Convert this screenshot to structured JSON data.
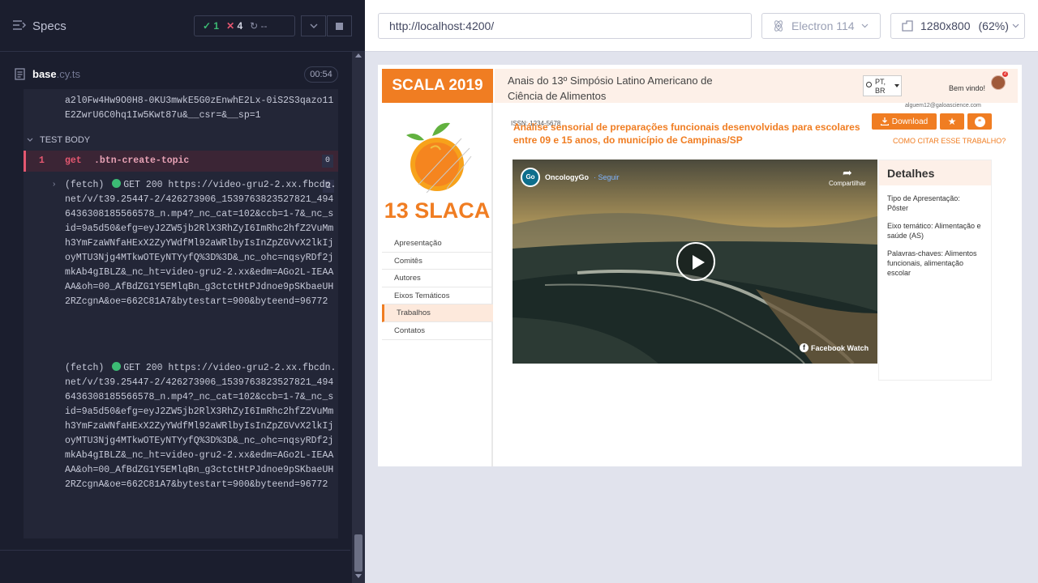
{
  "runner": {
    "specs_label": "Specs",
    "passed": "1",
    "failed": "4",
    "pending": "--",
    "file_name": "base",
    "file_ext": ".cy.ts",
    "duration": "00:54",
    "prev_log": "a2l0Fw4Hw9O0H8-0KU3mwkE5G0zEnwhE2Lx-0iS2S3qazo11E2ZwrU6C0hq1Iw5Kwt87u&__csr=&__sp=1",
    "test_body_label": "TEST BODY",
    "command": {
      "number": "1",
      "name": "get",
      "selector": ".btn-create-topic",
      "count": "0"
    },
    "fetch_count": "2",
    "fetch_logs": [
      {
        "prefix": "(fetch)",
        "text": "GET 200 https://video-gru2-2.xx.fbcdn.net/v/t39.25447-2/426273906_1539763823527821_4946436308185566578_n.mp4?_nc_cat=102&ccb=1-7&_nc_sid=9a5d50&efg=eyJ2ZW5jb2RlX3RhZyI6ImRhc2hfZ2VuMmh3YmFzaWNfaHExX2ZyYWdfMl92aWRlbyIsInZpZGVvX2lkIjoyMTU3Njg4MTkwOTEyNTYyfQ%3D%3D&_nc_ohc=nqsyRDf2jmkAb4gIBLZ&_nc_ht=video-gru2-2.xx&edm=AGo2L-IEAAAA&oh=00_AfBdZG1Y5EMlqBn_g3ctctHtPJdnoe9pSKbaeUH2RZcgnA&oe=662C81A7&bytestart=900&byteend=96772"
      },
      {
        "prefix": "(fetch)",
        "text": "GET 200 https://video-gru2-2.xx.fbcdn.net/v/t39.25447-2/426273906_1539763823527821_4946436308185566578_n.mp4?_nc_cat=102&ccb=1-7&_nc_sid=9a5d50&efg=eyJ2ZW5jb2RlX3RhZyI6ImRhc2hfZ2VuMmh3YmFzaWNfaHExX2ZyYWdfMl92aWRlbyIsInZpZGVvX2lkIjoyMTU3Njg4MTkwOTEyNTYyfQ%3D%3D&_nc_ohc=nqsyRDf2jmkAb4gIBLZ&_nc_ht=video-gru2-2.xx&edm=AGo2L-IEAAAA&oh=00_AfBdZG1Y5EMlqBn_g3ctctHtPJdnoe9pSKbaeUH2RZcgnA&oe=662C81A7&bytestart=900&byteend=96772"
      }
    ]
  },
  "preview": {
    "url": "http://localhost:4200/",
    "browser": "Electron 114",
    "viewport": "1280x800",
    "scale": "(62%)"
  },
  "site": {
    "logo_text": "SCALA 2019",
    "emblem_text": "13 SLACA",
    "header_title": "Anais do 13º Simpósio Latino Americano de Ciência de Alimentos",
    "lang": "PT, BR",
    "welcome": "Bem vindo!",
    "notif_count": "2",
    "email": "alguem12@galoascience.com",
    "issn": "ISSN: 1234-5678",
    "paper_title": "Análise sensorial de preparações funcionais desenvolvidas para escolares entre 09 e 15 anos, do município de Campinas/SP",
    "download_label": "Download",
    "cite_label": "COMO CITAR ESSE TRABALHO?",
    "nav": [
      "Apresentação",
      "Comitês",
      "Autores",
      "Eixos Temáticos",
      "Trabalhos",
      "Contatos"
    ],
    "video": {
      "channel": "OncologyGo",
      "follow": "· Seguir",
      "logo": "Go",
      "share": "Compartilhar",
      "watermark": "Facebook Watch"
    },
    "details": {
      "title": "Detalhes",
      "presentation": "Tipo de Apresentação: Pôster",
      "theme": "Eixo temático: Alimentação e saúde (AS)",
      "keywords": "Palavras-chaves: Alimentos funcionais, alimentação escolar"
    }
  }
}
